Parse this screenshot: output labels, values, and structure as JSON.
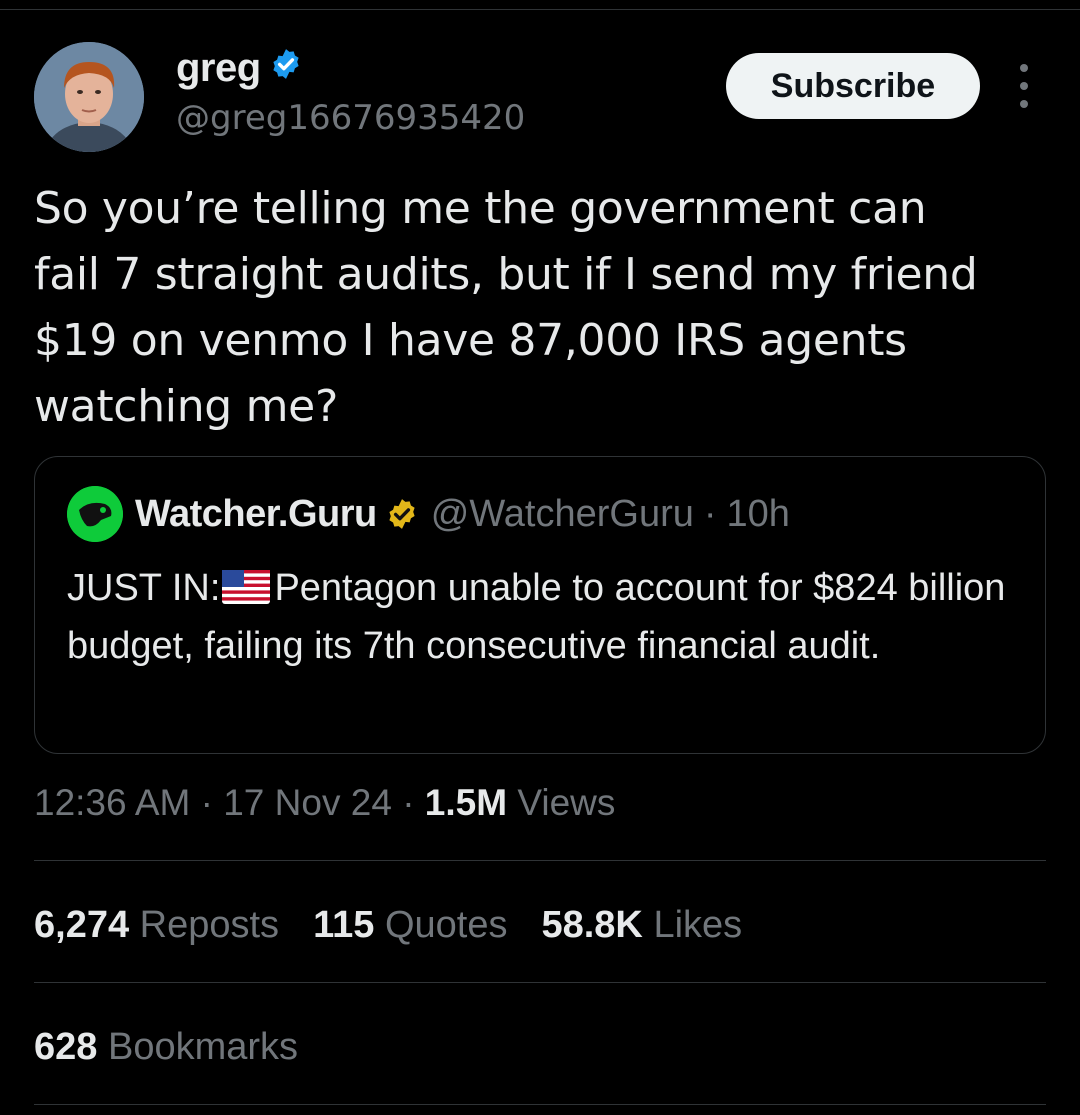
{
  "author": {
    "name": "greg",
    "handle": "@greg16676935420",
    "verified_icon": "blue-verified-badge"
  },
  "actions": {
    "subscribe_label": "Subscribe",
    "more_icon": "more-vertical-icon"
  },
  "tweet": {
    "text": "So you’re telling me the government can\nfail 7 straight audits, but if I send my friend\n$19 on venmo I have 87,000 IRS agents\nwatching me?"
  },
  "quote": {
    "name": "Watcher.Guru",
    "handle": "@WatcherGuru",
    "separator": "·",
    "time": "10h",
    "text_before_flag": "JUST IN:",
    "flag_icon": "us-flag-emoji",
    "text_after_flag": "Pentagon unable to account for $824 billion budget, failing its 7th consecutive financial audit."
  },
  "meta": {
    "time": "12:36 AM",
    "sep1": "·",
    "date": "17 Nov 24",
    "sep2": "·",
    "views_count": "1.5M",
    "views_label": "Views"
  },
  "stats": {
    "reposts_count": "6,274",
    "reposts_label": "Reposts",
    "quotes_count": "115",
    "quotes_label": "Quotes",
    "likes_count": "58.8K",
    "likes_label": "Likes",
    "bookmarks_count": "628",
    "bookmarks_label": "Bookmarks"
  },
  "colors": {
    "background": "#000000",
    "text": "#e7e9ea",
    "secondary": "#71767b",
    "border": "#2f3336",
    "verified_blue": "#1d9bf0",
    "verified_gold": "#e2b719",
    "watcher_green": "#0ecb3a"
  }
}
